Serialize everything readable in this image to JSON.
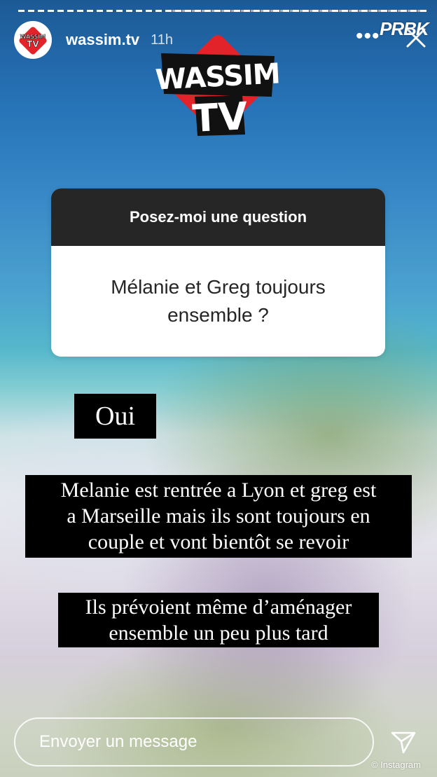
{
  "story": {
    "username": "wassim.tv",
    "time": "11h",
    "more_label": "•••",
    "watermark": "PRBK",
    "credit": "© Instagram"
  },
  "logo": {
    "line1": "WASSIM",
    "line2": "TV",
    "colors": {
      "red": "#e3232a",
      "black": "#111111",
      "white": "#ffffff"
    }
  },
  "avatar": {
    "line1": "WASSIM",
    "line2": "TV"
  },
  "question_sticker": {
    "header": "Posez-moi une question",
    "question": "Mélanie et Greg toujours ensemble ?"
  },
  "captions": [
    "Oui",
    "Melanie est rentrée a Lyon et greg est\na Marseille mais ils sont toujours en\ncouple et vont bientôt se revoir",
    "Ils prévoient même d’aménager\nensemble un peu plus tard"
  ],
  "reply": {
    "placeholder": "Envoyer un message"
  }
}
